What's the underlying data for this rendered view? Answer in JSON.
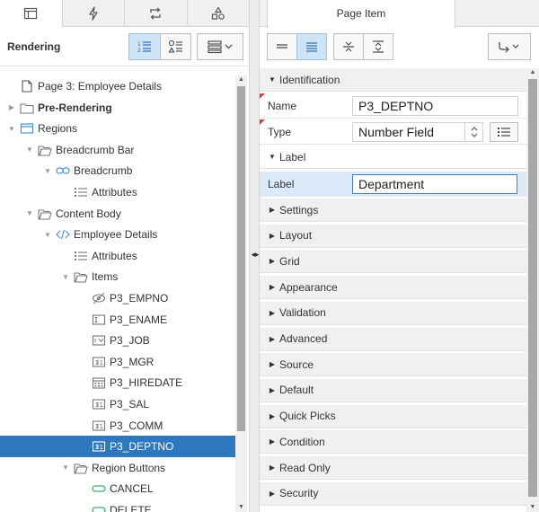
{
  "left": {
    "tabs": [
      "rendering-tab-icon",
      "dynamic-actions-icon",
      "processing-icon",
      "shared-components-icon"
    ],
    "header_title": "Rendering",
    "tree": [
      {
        "label": "Page 3: Employee Details",
        "icon": "page-icon",
        "toggle": "",
        "bold": false
      },
      {
        "label": "Pre-Rendering",
        "icon": "folder-icon",
        "toggle": "▶",
        "bold": true
      },
      {
        "label": "Regions",
        "icon": "region-icon",
        "toggle": "▼",
        "bold": false
      },
      {
        "label": "Breadcrumb Bar",
        "icon": "folder-open-icon",
        "toggle": "▼",
        "bold": false
      },
      {
        "label": "Breadcrumb",
        "icon": "breadcrumb-icon",
        "toggle": "▼",
        "bold": false
      },
      {
        "label": "Attributes",
        "icon": "attributes-icon",
        "toggle": "",
        "bold": false
      },
      {
        "label": "Content Body",
        "icon": "folder-open-icon",
        "toggle": "▼",
        "bold": false
      },
      {
        "label": "Employee Details",
        "icon": "code-icon",
        "toggle": "▼",
        "bold": false
      },
      {
        "label": "Attributes",
        "icon": "attributes-icon",
        "toggle": "",
        "bold": false
      },
      {
        "label": "Items",
        "icon": "folder-open-icon",
        "toggle": "▼",
        "bold": false
      },
      {
        "label": "P3_EMPNO",
        "icon": "hidden-item-icon",
        "toggle": "",
        "bold": false
      },
      {
        "label": "P3_ENAME",
        "icon": "text-field-icon",
        "toggle": "",
        "bold": false
      },
      {
        "label": "P3_JOB",
        "icon": "select-list-icon",
        "toggle": "",
        "bold": false
      },
      {
        "label": "P3_MGR",
        "icon": "number-field-icon",
        "toggle": "",
        "bold": false
      },
      {
        "label": "P3_HIREDATE",
        "icon": "date-picker-icon",
        "toggle": "",
        "bold": false
      },
      {
        "label": "P3_SAL",
        "icon": "number-field-icon",
        "toggle": "",
        "bold": false
      },
      {
        "label": "P3_COMM",
        "icon": "number-field-icon",
        "toggle": "",
        "bold": false
      },
      {
        "label": "P3_DEPTNO",
        "icon": "number-field-icon",
        "toggle": "",
        "bold": false,
        "selected": true
      },
      {
        "label": "Region Buttons",
        "icon": "folder-open-icon",
        "toggle": "▼",
        "bold": false
      },
      {
        "label": "CANCEL",
        "icon": "button-icon",
        "toggle": "",
        "bold": false
      },
      {
        "label": "DELETE",
        "icon": "button-icon",
        "toggle": "",
        "bold": false
      }
    ]
  },
  "right": {
    "tab_label": "Page Item",
    "sections": {
      "identification": "Identification",
      "label": "Label"
    },
    "fields": {
      "name_label": "Name",
      "name_value": "P3_DEPTNO",
      "type_label": "Type",
      "type_value": "Number Field",
      "label_label": "Label",
      "label_value": "Department"
    },
    "collapsed_sections": [
      "Settings",
      "Layout",
      "Grid",
      "Appearance",
      "Validation",
      "Advanced",
      "Source",
      "Default",
      "Quick Picks",
      "Condition",
      "Read Only",
      "Security"
    ]
  }
}
